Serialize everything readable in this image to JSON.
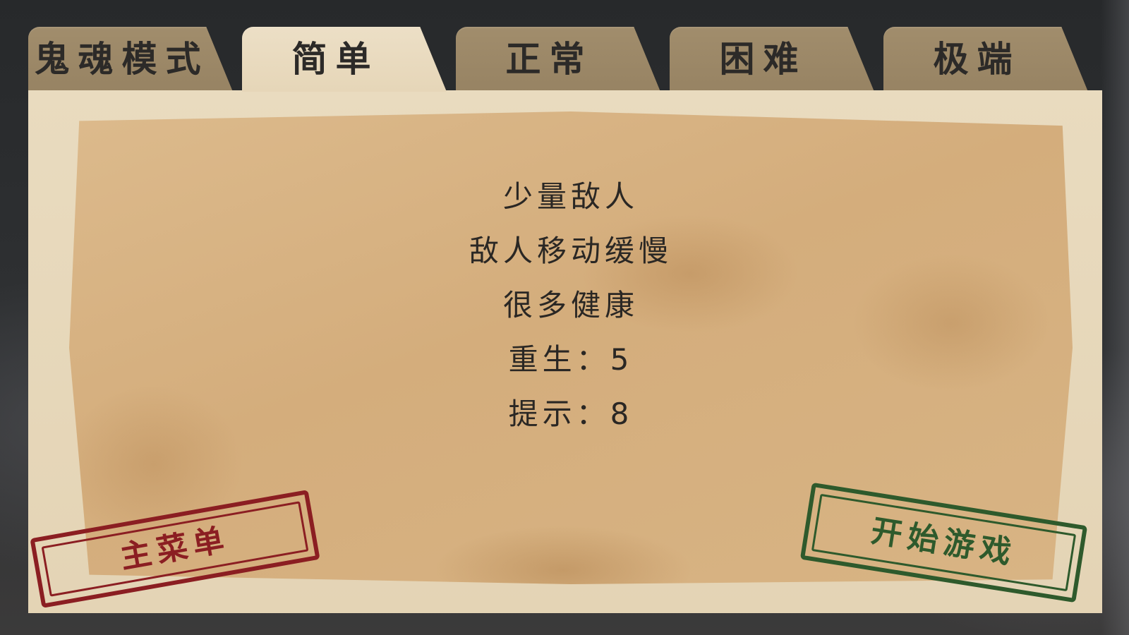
{
  "tabs": [
    {
      "label": "鬼魂模式",
      "active": false
    },
    {
      "label": "简单",
      "active": true
    },
    {
      "label": "正常",
      "active": false
    },
    {
      "label": "困难",
      "active": false
    },
    {
      "label": "极端",
      "active": false
    }
  ],
  "difficulty_info": {
    "lines": [
      "少量敌人",
      "敌人移动缓慢",
      "很多健康",
      "重生：5",
      "提示：8"
    ]
  },
  "buttons": {
    "main_menu": "主菜单",
    "start_game": "开始游戏"
  },
  "colors": {
    "tab_inactive": "#9c8868",
    "tab_active": "#e9dbbf",
    "paper": "#d6b080",
    "text": "#2a2724",
    "stamp_red": "#8b1e22",
    "stamp_green": "#2e5a2c"
  }
}
